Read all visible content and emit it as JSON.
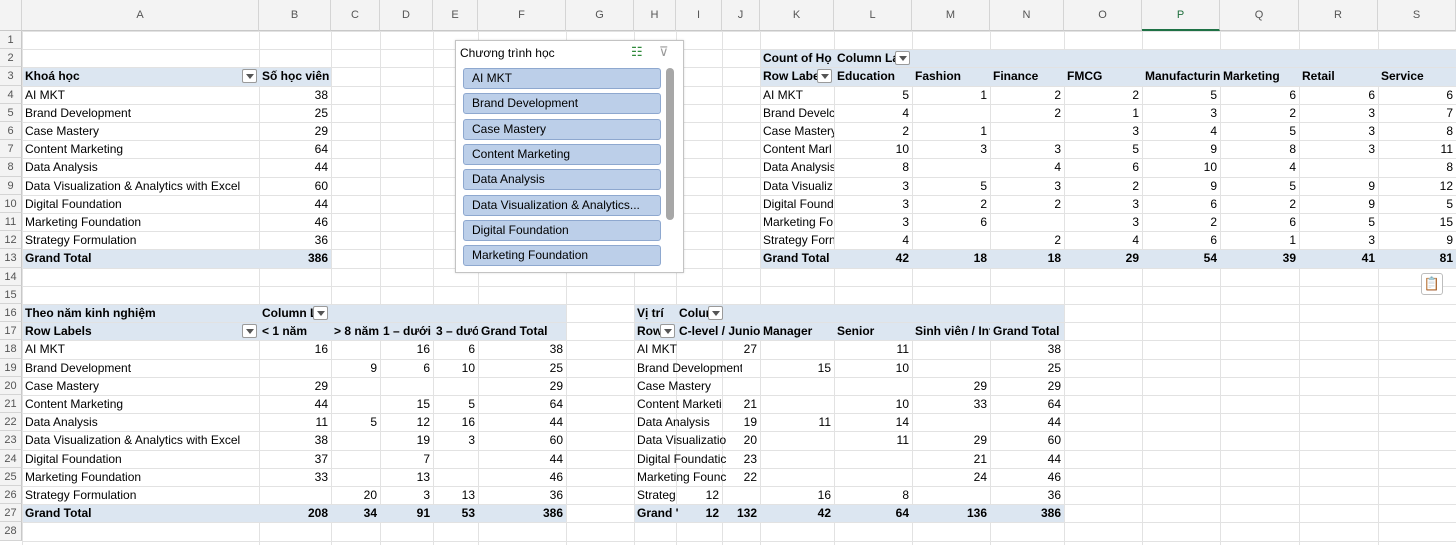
{
  "columns": [
    "A",
    "B",
    "C",
    "D",
    "E",
    "F",
    "G",
    "H",
    "I",
    "J",
    "K",
    "L",
    "M",
    "N",
    "O",
    "P",
    "Q",
    "R",
    "S"
  ],
  "selected_column": "P",
  "rows": [
    "1",
    "2",
    "3",
    "4",
    "5",
    "6",
    "7",
    "8",
    "9",
    "10",
    "11",
    "12",
    "13",
    "14",
    "15",
    "16",
    "17",
    "18",
    "19",
    "20",
    "21",
    "22",
    "23",
    "24",
    "25",
    "26",
    "27",
    "28"
  ],
  "pivot1": {
    "header_label": "Khoá học",
    "value_header": "Số học viên",
    "rows": [
      {
        "label": "AI MKT",
        "value": "38"
      },
      {
        "label": "Brand Development",
        "value": "25"
      },
      {
        "label": "Case Mastery",
        "value": "29"
      },
      {
        "label": "Content Marketing",
        "value": "64"
      },
      {
        "label": "Data Analysis",
        "value": "44"
      },
      {
        "label": "Data Visualization & Analytics with Excel",
        "value": "60"
      },
      {
        "label": "Digital Foundation",
        "value": "44"
      },
      {
        "label": "Marketing Foundation",
        "value": "46"
      },
      {
        "label": "Strategy Formulation",
        "value": "36"
      }
    ],
    "total_label": "Grand Total",
    "total_value": "386"
  },
  "slicer": {
    "title": "Chương trình học",
    "items": [
      "AI MKT",
      "Brand Development",
      "Case Mastery",
      "Content Marketing",
      "Data Analysis",
      "Data Visualization  & Analytics...",
      "Digital Foundation",
      "Marketing Foundation"
    ]
  },
  "pivot2": {
    "count_label": "Count of Họ",
    "col_labels": "Column La",
    "row_labels": "Row Labe",
    "columns": [
      "Education",
      "Fashion",
      "Finance",
      "FMCG",
      "Manufacturing",
      "Marketing",
      "Retail",
      "Service"
    ],
    "rows": [
      {
        "label": "AI MKT",
        "values": [
          "5",
          "1",
          "2",
          "2",
          "5",
          "6",
          "6",
          "6"
        ]
      },
      {
        "label": "Brand Develc",
        "values": [
          "4",
          "",
          "2",
          "1",
          "3",
          "2",
          "3",
          "7"
        ]
      },
      {
        "label": "Case Mastery",
        "values": [
          "2",
          "1",
          "",
          "3",
          "4",
          "5",
          "3",
          "8"
        ]
      },
      {
        "label": "Content Marl",
        "values": [
          "10",
          "3",
          "3",
          "5",
          "9",
          "8",
          "3",
          "11"
        ]
      },
      {
        "label": "Data Analysis",
        "values": [
          "8",
          "",
          "4",
          "6",
          "10",
          "4",
          "",
          "8"
        ]
      },
      {
        "label": "Data Visualiz",
        "values": [
          "3",
          "5",
          "3",
          "2",
          "9",
          "5",
          "9",
          "12"
        ]
      },
      {
        "label": "Digital Found",
        "values": [
          "3",
          "2",
          "2",
          "3",
          "6",
          "2",
          "9",
          "5"
        ]
      },
      {
        "label": "Marketing Fo",
        "values": [
          "3",
          "6",
          "",
          "3",
          "2",
          "6",
          "5",
          "15"
        ]
      },
      {
        "label": "Strategy Forn",
        "values": [
          "4",
          "",
          "2",
          "4",
          "6",
          "1",
          "3",
          "9"
        ]
      }
    ],
    "total_label": "Grand Total",
    "totals": [
      "42",
      "18",
      "18",
      "29",
      "54",
      "39",
      "41",
      "81"
    ]
  },
  "pivot3": {
    "title": "Theo năm kinh nghiệm",
    "col_labels": "Column L",
    "row_labels": "Row Labels",
    "columns": [
      "< 1 năm",
      "> 8 năm",
      "1 – dưới",
      "3 – dướ",
      "Grand Total"
    ],
    "rows": [
      {
        "label": "AI MKT",
        "values": [
          "16",
          "",
          "16",
          "6",
          "38"
        ]
      },
      {
        "label": "Brand Development",
        "values": [
          "",
          "9",
          "6",
          "10",
          "25"
        ]
      },
      {
        "label": "Case Mastery",
        "values": [
          "29",
          "",
          "",
          "",
          "29"
        ]
      },
      {
        "label": "Content Marketing",
        "values": [
          "44",
          "",
          "15",
          "5",
          "64"
        ]
      },
      {
        "label": "Data Analysis",
        "values": [
          "11",
          "5",
          "12",
          "16",
          "44"
        ]
      },
      {
        "label": "Data Visualization & Analytics with Excel",
        "values": [
          "38",
          "",
          "19",
          "3",
          "60"
        ]
      },
      {
        "label": "Digital Foundation",
        "values": [
          "37",
          "",
          "7",
          "",
          "44"
        ]
      },
      {
        "label": "Marketing Foundation",
        "values": [
          "33",
          "",
          "13",
          "",
          "46"
        ]
      },
      {
        "label": "Strategy Formulation",
        "values": [
          "",
          "20",
          "3",
          "13",
          "36"
        ]
      }
    ],
    "total_label": "Grand Total",
    "totals": [
      "208",
      "34",
      "91",
      "53",
      "386"
    ]
  },
  "pivot4": {
    "title": "Vị trí",
    "col_labels": "Colun",
    "row_labels": "Row",
    "columns": [
      "",
      "C-level / Junior",
      "Manager",
      "Senior",
      "Sinh viên / Int",
      "Grand Total"
    ],
    "rows": [
      {
        "label": "AI MKT",
        "values": [
          "",
          "27",
          "",
          "11",
          "",
          "38"
        ]
      },
      {
        "label": "Brand Development",
        "values": [
          "",
          "",
          "15",
          "10",
          "",
          "25"
        ]
      },
      {
        "label": "Case Mastery",
        "values": [
          "",
          "",
          "",
          "",
          "29",
          "29"
        ]
      },
      {
        "label": "Content Marketi",
        "values": [
          "",
          "21",
          "",
          "10",
          "33",
          "64"
        ]
      },
      {
        "label": "Data Analysis",
        "values": [
          "",
          "19",
          "11",
          "14",
          "",
          "44"
        ]
      },
      {
        "label": "Data Visualizatio",
        "values": [
          "",
          "20",
          "",
          "11",
          "29",
          "60"
        ]
      },
      {
        "label": "Digital Foundatic",
        "values": [
          "",
          "23",
          "",
          "",
          "21",
          "44"
        ]
      },
      {
        "label": "Marketing Founc",
        "values": [
          "",
          "22",
          "",
          "",
          "24",
          "46"
        ]
      },
      {
        "label": "Strateg",
        "values": [
          "12",
          "",
          "16",
          "8",
          "",
          "36"
        ]
      }
    ],
    "total_label": "Grand '",
    "totals": [
      "12",
      "132",
      "42",
      "64",
      "136",
      "386"
    ]
  },
  "icons": {
    "multi_select": "multi-select-icon",
    "clear_filter": "clear-filter-icon",
    "paste_options": "paste-options-icon"
  }
}
